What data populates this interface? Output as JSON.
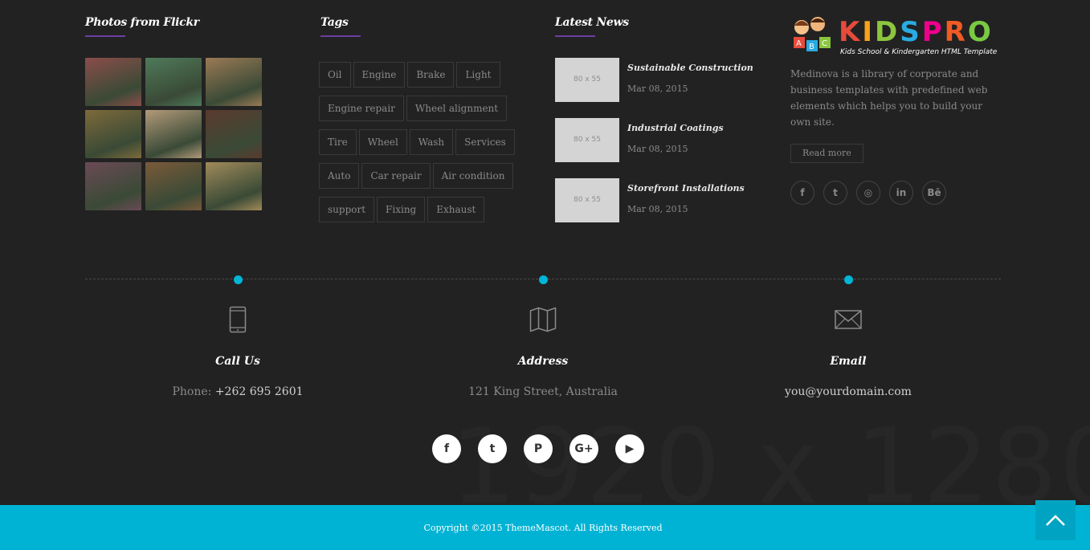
{
  "flickr": {
    "title": "Photos from Flickr",
    "photos": [
      {
        "icon": "photo-costume-1",
        "color": "#8b4d4a"
      },
      {
        "icon": "photo-group-1",
        "color": "#4f7a5a"
      },
      {
        "icon": "photo-costume-2",
        "color": "#9a7a55"
      },
      {
        "icon": "photo-costume-3",
        "color": "#7d6a3a"
      },
      {
        "icon": "photo-costume-4",
        "color": "#b29a7a"
      },
      {
        "icon": "photo-costume-5",
        "color": "#5a3a2e"
      },
      {
        "icon": "photo-costume-6",
        "color": "#6b4a56"
      },
      {
        "icon": "photo-costume-7",
        "color": "#7a5a3a"
      },
      {
        "icon": "photo-costume-8",
        "color": "#a08a5a"
      }
    ]
  },
  "tags": {
    "title": "Tags",
    "items": [
      "Oil",
      "Engine",
      "Brake",
      "Light",
      "Engine repair",
      "Wheel alignment",
      "Tire",
      "Wheel",
      "Wash",
      "Services",
      "Auto",
      "Car repair",
      "Air condition",
      "support",
      "Fixing",
      "Exhaust"
    ]
  },
  "news": {
    "title": "Latest News",
    "items": [
      {
        "thumb": "80 x 55",
        "title": "Sustainable Construction",
        "date": "Mar 08, 2015"
      },
      {
        "thumb": "80 x 55",
        "title": "Industrial Coatings",
        "date": "Mar 08, 2015"
      },
      {
        "thumb": "80 x 55",
        "title": "Storefront Installations",
        "date": "Mar 08, 2015"
      }
    ]
  },
  "brand": {
    "logo_text": "KIDSPRO",
    "logo_letter_colors": [
      "#e84b3a",
      "#f7a21b",
      "#8cc63f",
      "#29abe2",
      "#ec008c",
      "#f15a24",
      "#7ac943"
    ],
    "logo_sub": "Kids School & Kindergarten HTML Template",
    "description": "Medinova is a library of corporate and business templates with predefined web elements which helps you to build your own site.",
    "read_more": "Read more",
    "social": [
      {
        "icon": "facebook-icon",
        "glyph": "f"
      },
      {
        "icon": "twitter-icon",
        "glyph": "t"
      },
      {
        "icon": "instagram-icon",
        "glyph": "◎"
      },
      {
        "icon": "linkedin-icon",
        "glyph": "in"
      },
      {
        "icon": "behance-icon",
        "glyph": "Bē"
      }
    ]
  },
  "contact": {
    "call": {
      "icon": "phone-icon",
      "title": "Call Us",
      "label": "Phone: ",
      "value": "+262 695 2601"
    },
    "address": {
      "icon": "map-icon",
      "title": "Address",
      "value": "121 King Street, Australia"
    },
    "email": {
      "icon": "envelope-icon",
      "title": "Email",
      "value": "you@yourdomain.com"
    }
  },
  "social_bottom": [
    {
      "icon": "facebook-icon",
      "glyph": "f"
    },
    {
      "icon": "twitter-icon",
      "glyph": "t"
    },
    {
      "icon": "pinterest-icon",
      "glyph": "P"
    },
    {
      "icon": "google-plus-icon",
      "glyph": "G+"
    },
    {
      "icon": "youtube-icon",
      "glyph": "▶"
    }
  ],
  "watermark": "1920 x 1280",
  "footer": {
    "copyright": "Copyright ©2015 ThemeMascot. All Rights Reserved",
    "accent": "#00b3d4"
  }
}
